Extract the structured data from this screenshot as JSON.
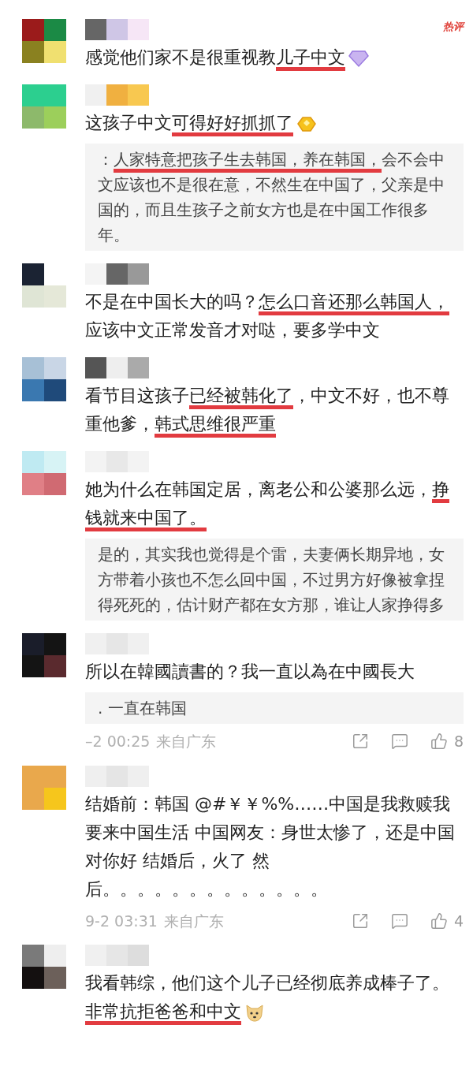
{
  "comments": [
    {
      "badge": "热评",
      "emoji": {
        "kind": "diamond"
      },
      "segments": [
        {
          "text": "感觉他们家不是很重视教",
          "underlined": false
        },
        {
          "text": "儿子中文",
          "underlined": true
        }
      ]
    },
    {
      "emoji": {
        "kind": "ingot"
      },
      "segments": [
        {
          "text": "这孩子中文",
          "underlined": false
        },
        {
          "text": "可得好好抓抓了",
          "underlined": true
        }
      ],
      "reply": {
        "segments": [
          {
            "text": "：",
            "underlined": false
          },
          {
            "text": "人家特意把孩子生去韩国，养在韩国，",
            "underlined": true
          },
          {
            "text": "会不会中文应该也不是很在意，不然生在中国了，父亲是中国的，而且生孩子之前女方也是在中国工作很多年。",
            "underlined": false
          }
        ]
      }
    },
    {
      "segments": [
        {
          "text": "不是在中国长大的吗？",
          "underlined": false
        },
        {
          "text": "怎么口音还那么韩国人，",
          "underlined": true
        },
        {
          "text": "应该中文正常发音才对哒，要多学中文",
          "underlined": false
        }
      ]
    },
    {
      "segments": [
        {
          "text": "看节目这孩子",
          "underlined": false
        },
        {
          "text": "已经被韩化了",
          "underlined": true
        },
        {
          "text": "，中文不好，也不尊重他爹，",
          "underlined": false
        },
        {
          "text": "韩式思维很严重",
          "underlined": true
        }
      ]
    },
    {
      "segments": [
        {
          "text": "她为什么在韩国定居，离老公和公婆那么远，",
          "underlined": false
        },
        {
          "text": "挣钱就来中国了。",
          "underlined": true
        }
      ],
      "reply": {
        "segments": [
          {
            "text": "是的，其实我也觉得是个雷，夫妻俩长期异地，女方带着小孩也不怎么回中国，不过男方好像被拿捏得死死的，估计财产都在女方那，谁让人家挣得多",
            "underlined": false
          }
        ]
      }
    },
    {
      "segments": [
        {
          "text": "所以在韓國讀書的？我一直以為在中國長大",
          "underlined": false
        }
      ],
      "reply": {
        "segments": [
          {
            "text": ". 一直在韩国",
            "underlined": false
          }
        ]
      },
      "footer": {
        "time": "–2 00:25",
        "location": "来自广东",
        "likes": "8"
      }
    },
    {
      "segments": [
        {
          "text": "结婚前：韩国 @#￥￥%%……中国是我救赎我要来中国生活 中国网友：身世太惨了，还是中国对你好 结婚后，火了 然后。。。。。。。。。。。。。",
          "underlined": false
        }
      ],
      "footer": {
        "time": "9-2 03:31",
        "location": "来自广东",
        "likes": "4"
      }
    },
    {
      "emoji": {
        "kind": "dog"
      },
      "segments": [
        {
          "text": "我看韩综，他们这个儿子已经彻底养成棒子了。",
          "underlined": false
        },
        {
          "text": "非常抗拒爸爸和中文",
          "underlined": true
        }
      ]
    }
  ]
}
